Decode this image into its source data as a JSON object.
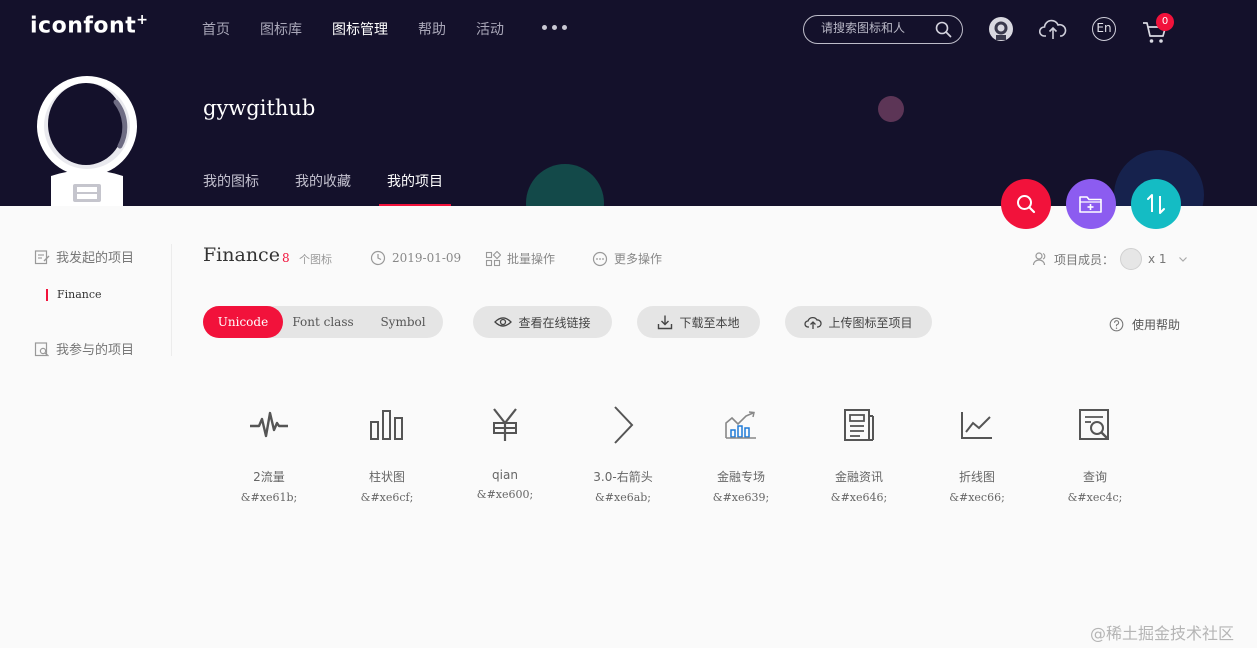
{
  "header": {
    "logo": "iconfont",
    "nav": [
      "首页",
      "图标库",
      "图标管理",
      "帮助",
      "活动"
    ],
    "nav_active_index": 2,
    "search_placeholder": "请搜索图标和人",
    "cart_count": "0",
    "lang_label": "En"
  },
  "profile": {
    "username": "gywgithub",
    "tabs": [
      "我的图标",
      "我的收藏",
      "我的项目"
    ],
    "active_tab_index": 2
  },
  "sidebar": {
    "started": "我发起的项目",
    "joined": "我参与的项目",
    "items": [
      "Finance"
    ]
  },
  "project": {
    "title": "Finance",
    "count": "8",
    "count_label": "个图标",
    "date": "2019-01-09",
    "batch": "批量操作",
    "more": "更多操作",
    "members_label": "项目成员：",
    "members_count": "x 1"
  },
  "toolbar": {
    "modes": [
      "Unicode",
      "Font class",
      "Symbol"
    ],
    "active_mode": 0,
    "view_online": "查看在线链接",
    "download": "下载至本地",
    "upload": "上传图标至项目",
    "help": "使用帮助"
  },
  "icons": [
    {
      "name": "2流量",
      "code": "&#xe61b;",
      "icon": "pulse-icon"
    },
    {
      "name": "柱状图",
      "code": "&#xe6cf;",
      "icon": "bar-chart-icon"
    },
    {
      "name": "qian",
      "code": "&#xe600;",
      "icon": "yuan-icon"
    },
    {
      "name": "3.0-右箭头",
      "code": "&#xe6ab;",
      "icon": "arrow-right-icon"
    },
    {
      "name": "金融专场",
      "code": "&#xe639;",
      "icon": "finance-chart-icon"
    },
    {
      "name": "金融资讯",
      "code": "&#xe646;",
      "icon": "news-icon"
    },
    {
      "name": "折线图",
      "code": "&#xec66;",
      "icon": "line-chart-icon"
    },
    {
      "name": "查询",
      "code": "&#xec4c;",
      "icon": "doc-search-icon"
    }
  ],
  "watermark": "@稀土掘金技术社区",
  "colors": {
    "header_bg": "#14112b",
    "accent": "#f2123b",
    "fab_search": "#f2123b",
    "fab_folder": "#8c5cf0",
    "fab_sort": "#14bcc4"
  }
}
